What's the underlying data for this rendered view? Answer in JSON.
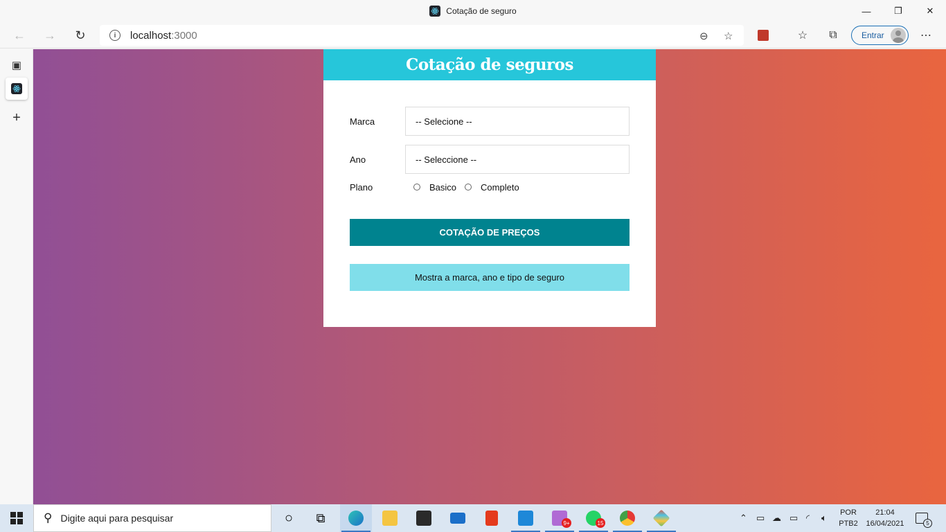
{
  "window": {
    "title": "Cotação de seguro",
    "minimize_glyph": "—",
    "restore_glyph": "❐",
    "close_glyph": "✕"
  },
  "toolbar": {
    "url_host": "localhost",
    "url_port": ":3000",
    "signin_label": "Entrar"
  },
  "app": {
    "heading": "Cotação de seguros",
    "brand_label": "Marca",
    "brand_value": "-- Selecione --",
    "year_label": "Ano",
    "year_value": "-- Seleccione --",
    "plan_label": "Plano",
    "plan_options": [
      "Basico",
      "Completo"
    ],
    "submit_label": "COTAÇÃO DE PREÇOS",
    "result_text": "Mostra a marca, ano e tipo de seguro"
  },
  "taskbar": {
    "search_placeholder": "Digite aqui para pesquisar",
    "whatsapp_badge": "15",
    "discord_badge": "9+",
    "language": "POR",
    "layout": "PTB2",
    "time": "21:04",
    "date": "16/04/2021",
    "notifications": "5"
  },
  "colors": {
    "header": "#26c6da",
    "button": "#00838f",
    "result": "#80deea",
    "gradient_start": "#914f95",
    "gradient_end": "#e9653f"
  },
  "icons": [
    "back-icon",
    "forward-icon",
    "refresh-icon",
    "info-icon",
    "zoom-out-icon",
    "add-favorite-icon",
    "extension-icon",
    "favorites-icon",
    "collections-icon",
    "more-icon",
    "tab-actions-icon",
    "new-tab-icon",
    "windows-start-icon",
    "search-icon",
    "cortana-icon",
    "task-view-icon"
  ]
}
